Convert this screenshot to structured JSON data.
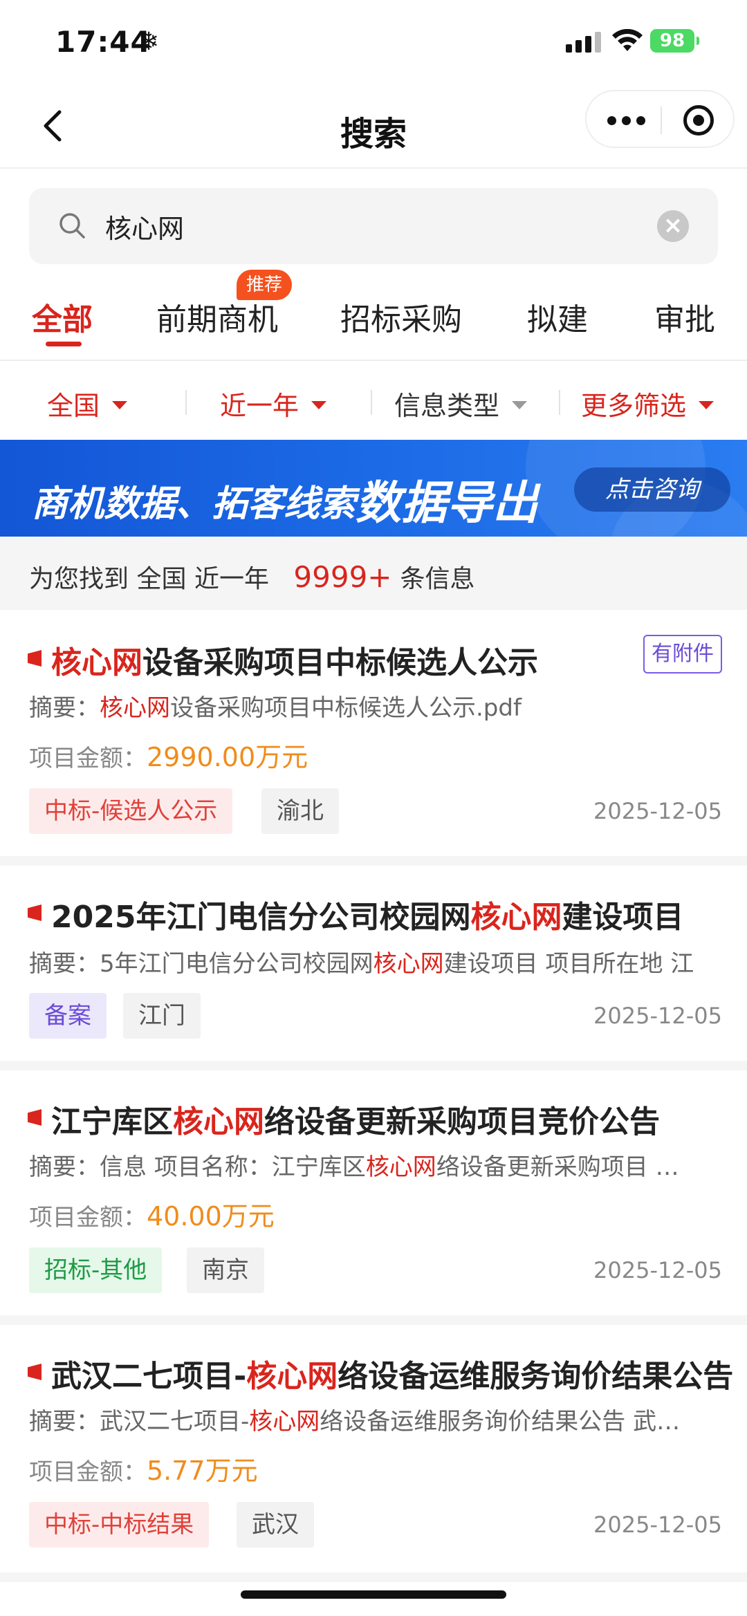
{
  "status_bar": {
    "time": "17:44",
    "battery": "98"
  },
  "nav": {
    "title": "搜索"
  },
  "search": {
    "value": "核心网",
    "placeholder": ""
  },
  "tabs": [
    {
      "label": "全部"
    },
    {
      "label": "前期商机",
      "badge": "推荐"
    },
    {
      "label": "招标采购"
    },
    {
      "label": "拟建"
    },
    {
      "label": "审批"
    }
  ],
  "filters": [
    {
      "label": "全国"
    },
    {
      "label": "近一年"
    },
    {
      "label": "信息类型"
    },
    {
      "label": "更多筛选"
    }
  ],
  "banner": {
    "text": "商机数据、拓客线索",
    "strong": "数据导出",
    "button": "点击咨询"
  },
  "summary": {
    "prefix": "为您找到",
    "region": "全国",
    "period": "近一年",
    "count": "9999+",
    "suffix": "条信息"
  },
  "colors": {
    "accent": "#d9251d",
    "amount": "#f08c1c",
    "banner": "#1c6ae6"
  },
  "results": [
    {
      "title_pre": "",
      "title_hl": "核心网",
      "title_post": "设备采购项目中标候选人公示",
      "attachment": "有附件",
      "abstract_label": "摘要：",
      "abstract_pre": "",
      "abstract_hl": "核心网",
      "abstract_post": "设备采购项目中标候选人公示.pdf",
      "amount_label": "项目金额：",
      "amount": "2990.00万元",
      "tags": [
        "中标-候选人公示",
        "渝北"
      ],
      "date": "2025-12-05"
    },
    {
      "title_pre": "2025年江门电信分公司校园网",
      "title_hl": "核心网",
      "title_post": "建设项目",
      "abstract_label": "摘要：",
      "abstract_pre": "5年江门电信分公司校园网",
      "abstract_hl": "核心网",
      "abstract_post": "建设项目 项目所在地 江",
      "tags": [
        "备案",
        "江门"
      ],
      "date": "2025-12-05"
    },
    {
      "title_pre": "江宁库区",
      "title_hl": "核心网",
      "title_post": "络设备更新采购项目竞价公告",
      "abstract_label": "摘要：",
      "abstract_pre": "信息 项目名称：江宁库区",
      "abstract_hl": "核心网",
      "abstract_post": "络设备更新采购项目 …",
      "amount_label": "项目金额：",
      "amount": "40.00万元",
      "tags": [
        "招标-其他",
        "南京"
      ],
      "date": "2025-12-05"
    },
    {
      "title_pre": "武汉二七项目-",
      "title_hl": "核心网",
      "title_post": "络设备运维服务询价结果公告",
      "abstract_label": "摘要：",
      "abstract_pre": "武汉二七项目-",
      "abstract_hl": "核心网",
      "abstract_post": "络设备运维服务询价结果公告 武…",
      "amount_label": "项目金额：",
      "amount": "5.77万元",
      "tags": [
        "中标-中标结果",
        "武汉"
      ],
      "date": "2025-12-05"
    }
  ]
}
